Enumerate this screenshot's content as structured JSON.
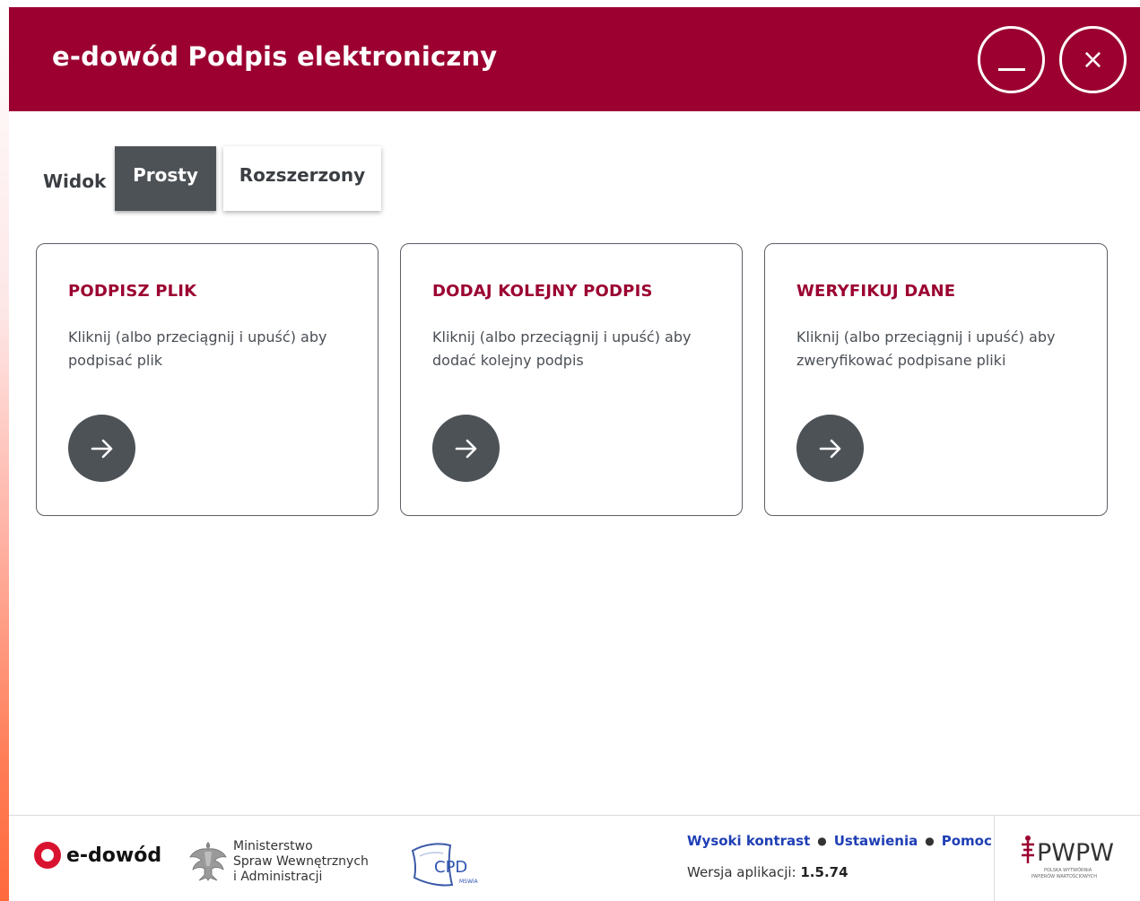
{
  "window": {
    "title": "e-dowód Podpis elektroniczny",
    "minimize_icon": "minimize-icon",
    "close_icon": "close-icon",
    "close_glyph": "×"
  },
  "view": {
    "label": "Widok",
    "options": [
      "Prosty",
      "Rozszerzony"
    ],
    "selected": "Prosty"
  },
  "cards": [
    {
      "title": "PODPISZ PLIK",
      "description": "Kliknij (albo przeciągnij i upuść) aby podpisać plik",
      "icon": "arrow-right-icon"
    },
    {
      "title": "DODAJ KOLEJNY PODPIS",
      "description": "Kliknij (albo przeciągnij i upuść) aby dodać kolejny podpis",
      "icon": "arrow-right-icon"
    },
    {
      "title": "WERYFIKUJ DANE",
      "description": "Kliknij (albo przeciągnij i upuść) aby zweryfikować podpisane pliki",
      "icon": "arrow-right-icon"
    }
  ],
  "footer": {
    "edowod_logo_text": "e-dowód",
    "mswia_lines": [
      "Ministerstwo",
      "Spraw Wewnętrznych",
      "i Administracji"
    ],
    "cpd_logo_text": "CPD",
    "cpd_logo_subtext": "MSWiA",
    "links": [
      "Wysoki kontrast",
      "Ustawienia",
      "Pomoc"
    ],
    "version_label": "Wersja aplikacji:",
    "version_value": "1.5.74",
    "pwpw_logo_text": "PWPW",
    "pwpw_logo_subtext": [
      "POLSKA WYTWÓRNIA",
      "PAPIERÓW WARTOŚCIOWYCH"
    ]
  },
  "colors": {
    "brand": "#9b0031",
    "dark_button": "#4d5257",
    "link": "#1f3fb5"
  }
}
